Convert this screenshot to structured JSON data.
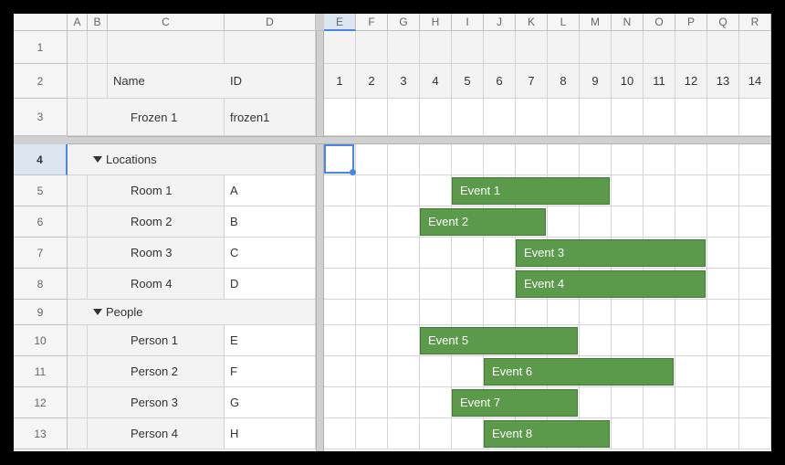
{
  "columns_left": [
    "A",
    "B",
    "C",
    "D"
  ],
  "columns_right": [
    "E",
    "F",
    "G",
    "H",
    "I",
    "J",
    "K",
    "L",
    "M",
    "N",
    "O",
    "P",
    "Q",
    "R"
  ],
  "header": {
    "name": "Name",
    "id": "ID"
  },
  "frozen_row": {
    "label": "Frozen 1",
    "id": "frozen1"
  },
  "groups": [
    {
      "title": "Locations",
      "rows": [
        {
          "name": "Room 1",
          "id": "A"
        },
        {
          "name": "Room 2",
          "id": "B"
        },
        {
          "name": "Room 3",
          "id": "C"
        },
        {
          "name": "Room 4",
          "id": "D"
        }
      ]
    },
    {
      "title": "People",
      "rows": [
        {
          "name": "Person 1",
          "id": "E"
        },
        {
          "name": "Person 2",
          "id": "F"
        },
        {
          "name": "Person 3",
          "id": "G"
        },
        {
          "name": "Person 4",
          "id": "H"
        }
      ]
    }
  ],
  "timeline_numbers": [
    "1",
    "2",
    "3",
    "4",
    "5",
    "6",
    "7",
    "8",
    "9",
    "10",
    "11",
    "12",
    "13",
    "14"
  ],
  "events": [
    {
      "label": "Event 1",
      "row": 0,
      "start": 5,
      "end": 9
    },
    {
      "label": "Event 2",
      "row": 1,
      "start": 4,
      "end": 7
    },
    {
      "label": "Event 3",
      "row": 2,
      "start": 7,
      "end": 12
    },
    {
      "label": "Event 4",
      "row": 3,
      "start": 7,
      "end": 12
    },
    {
      "label": "Event 5",
      "row": 5,
      "start": 4,
      "end": 8
    },
    {
      "label": "Event 6",
      "row": 6,
      "start": 6,
      "end": 11
    },
    {
      "label": "Event 7",
      "row": 7,
      "start": 5,
      "end": 8
    },
    {
      "label": "Event 8",
      "row": 8,
      "start": 6,
      "end": 9
    }
  ],
  "selected_cell": {
    "col": "E",
    "row": 4
  }
}
